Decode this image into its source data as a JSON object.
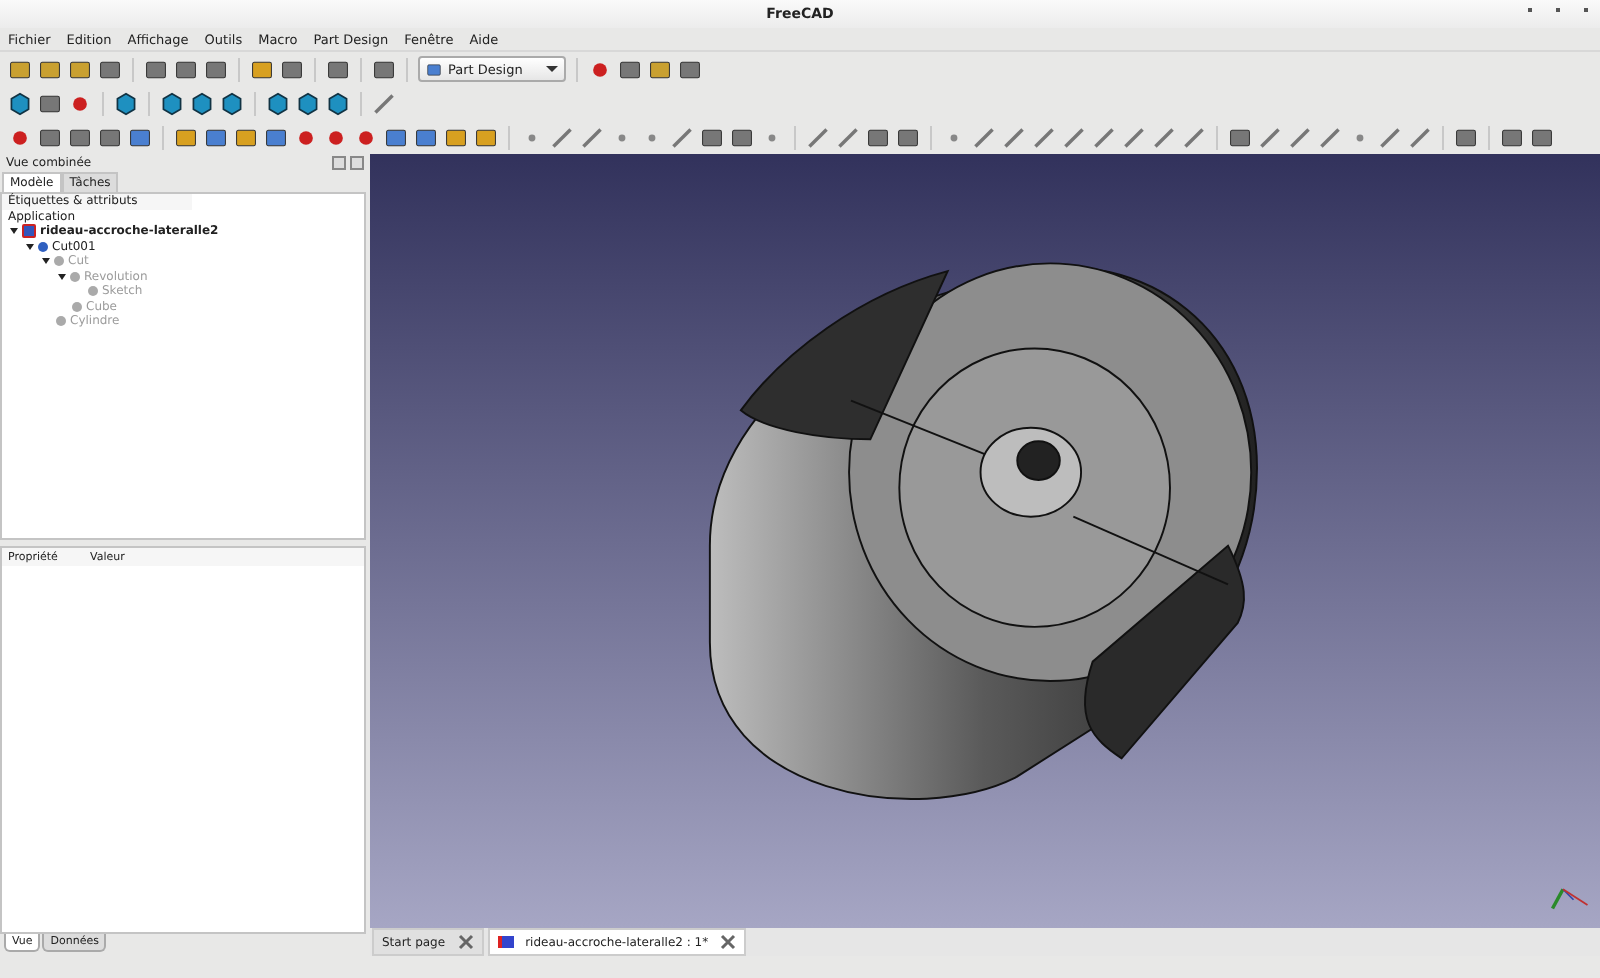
{
  "window": {
    "title": "FreeCAD"
  },
  "menu": [
    "Fichier",
    "Edition",
    "Affichage",
    "Outils",
    "Macro",
    "Part Design",
    "Fenêtre",
    "Aide"
  ],
  "workbench": {
    "value": "Part Design"
  },
  "panel": {
    "title": "Vue combinée",
    "tabs": [
      {
        "label": "Modèle",
        "selected": true
      },
      {
        "label": "Tâches",
        "selected": false
      }
    ],
    "tree_header": "Étiquettes & attributs",
    "tree_root": "Application",
    "tree": [
      {
        "label": "rideau-accroche-lateralle2",
        "kind": "document",
        "visible": true,
        "expanded": true,
        "children": [
          {
            "label": "Cut001",
            "kind": "object",
            "visible": true,
            "expanded": true,
            "children": [
              {
                "label": "Cut",
                "kind": "object",
                "visible": false,
                "expanded": true,
                "children": [
                  {
                    "label": "Revolution",
                    "kind": "object",
                    "visible": false,
                    "expanded": true,
                    "children": [
                      {
                        "label": "Sketch",
                        "kind": "object",
                        "visible": false
                      }
                    ]
                  },
                  {
                    "label": "Cube",
                    "kind": "object",
                    "visible": false
                  }
                ]
              },
              {
                "label": "Cylindre",
                "kind": "object",
                "visible": false
              }
            ]
          }
        ]
      }
    ],
    "property_columns": [
      "Propriété",
      "Valeur"
    ],
    "bottom_tabs": [
      {
        "label": "Vue",
        "selected": true
      },
      {
        "label": "Données",
        "selected": false
      }
    ]
  },
  "doc_tabs": [
    {
      "label": "Start page",
      "selected": false
    },
    {
      "label": "rideau-accroche-lateralle2 : 1*",
      "selected": true
    }
  ]
}
